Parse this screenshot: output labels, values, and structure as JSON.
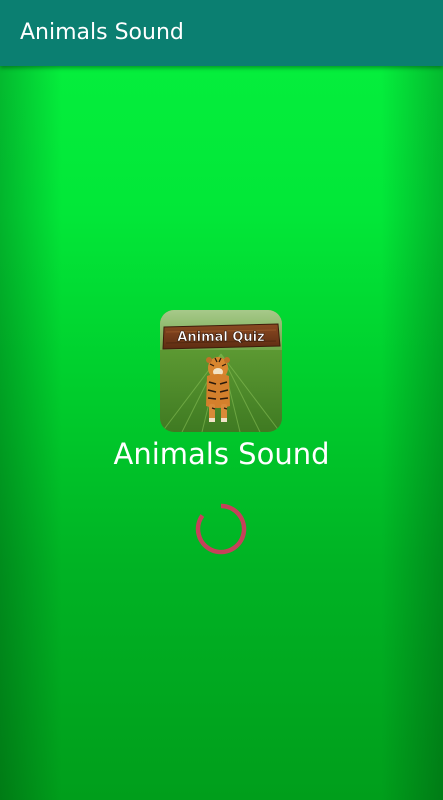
{
  "app": {
    "title": "Animals Sound"
  },
  "splash": {
    "logo": {
      "sign_text": "Animal Quiz",
      "image": "tiger-on-grass"
    },
    "title": "Animals Sound",
    "loading_indicator": "progress-spinner"
  },
  "colors": {
    "appbar": "#0b7f71",
    "background_top": "#05ee3c",
    "background_bottom": "#009e1b",
    "spinner": "#c6415a",
    "text": "#ffffff"
  }
}
